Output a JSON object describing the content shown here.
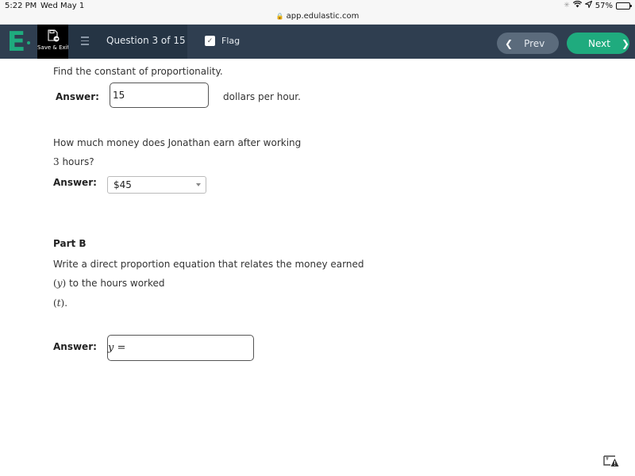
{
  "status_bar": {
    "time": "5:22 PM",
    "date": "Wed May 1",
    "url": "app.edulastic.com",
    "battery_percent": "57%",
    "battery_level": 0.57,
    "icons": [
      "loading-icon",
      "wifi-icon",
      "location-icon",
      "battery-icon"
    ]
  },
  "header": {
    "logo": "E",
    "save_exit_label": "Save & Exit",
    "question_label": "Question 3 of 15",
    "flag_label": "Flag",
    "flag_checked": true,
    "prev_label": "Prev",
    "next_label": "Next",
    "colors": {
      "header_bg": "#2f3e50",
      "brand_green": "#1fab7e",
      "prev_bg": "#5b6b7c"
    }
  },
  "content": {
    "q1": {
      "text": "Find the constant of proportionality.",
      "answer_label": "Answer:",
      "answer_value": "15",
      "unit": "dollars per hour."
    },
    "q2": {
      "text_line1": "How much money does Jonathan earn after working",
      "text_num": "3",
      "text_line2_rest": " hours?",
      "answer_label": "Answer:",
      "selected_value": "$45"
    },
    "part_b": {
      "title": "Part B",
      "text_line1": "Write a direct proportion equation that relates the money earned",
      "var_y": "y",
      "text_line2_rest": " to the hours worked",
      "var_t": "t",
      "answer_label": "Answer:",
      "equation_prefix_var": "y",
      "equation_prefix_op": " ="
    }
  },
  "footer": {
    "report_icon": "report-issue-icon"
  }
}
